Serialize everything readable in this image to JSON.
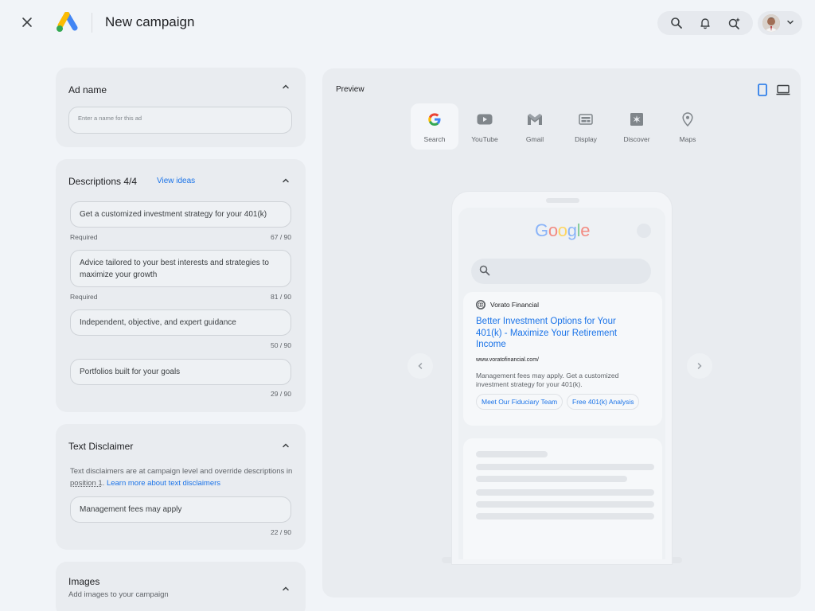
{
  "header": {
    "title": "New campaign"
  },
  "ad_name": {
    "title": "Ad name",
    "placeholder": "Enter a name for this ad",
    "value": ""
  },
  "descriptions": {
    "title": "Descriptions 4/4",
    "view_ideas": "View ideas",
    "items": [
      {
        "text": "Get a customized investment strategy for your 401(k)",
        "note": "Required",
        "count": "67 / 90"
      },
      {
        "text": "Advice tailored to your best interests and strategies to maximize your growth",
        "note": "Required",
        "count": "81 / 90"
      },
      {
        "text": "Independent, objective, and expert guidance",
        "note": "",
        "count": "50 / 90"
      },
      {
        "text": "Portfolios built for your goals",
        "note": "",
        "count": "29 / 90"
      }
    ]
  },
  "disclaimer": {
    "title": "Text Disclaimer",
    "info_prefix": "Text disclaimers are at campaign level and override descriptions in ",
    "info_position": "position 1",
    "info_suffix": ". ",
    "learn_more": "Learn more about text disclaimers",
    "value": "Management fees may apply",
    "count": "22 / 90"
  },
  "images": {
    "title": "Images",
    "subtitle": "Add images to your campaign"
  },
  "preview": {
    "label": "Preview",
    "channels": [
      {
        "label": "Search",
        "icon": "google-g-icon"
      },
      {
        "label": "YouTube",
        "icon": "youtube-icon"
      },
      {
        "label": "Gmail",
        "icon": "gmail-icon"
      },
      {
        "label": "Display",
        "icon": "display-icon"
      },
      {
        "label": "Discover",
        "icon": "discover-icon"
      },
      {
        "label": "Maps",
        "icon": "maps-pin-icon"
      }
    ],
    "google_logo": "Google",
    "ad": {
      "advertiser": "Vorato Financial",
      "headline": "Better Investment Options for Your 401(k) - Maximize Your Retirement Income",
      "url": "www.voratofinancial.com/",
      "description": "Management fees may apply. Get a customized investment strategy for your 401(k).",
      "sitelinks": [
        "Meet Our Fiduciary Team",
        "Free 401(k) Analysis"
      ]
    }
  },
  "colors": {
    "accent": "#1a73e8",
    "background": "#f1f4f8",
    "card": "#e9ecf0"
  }
}
